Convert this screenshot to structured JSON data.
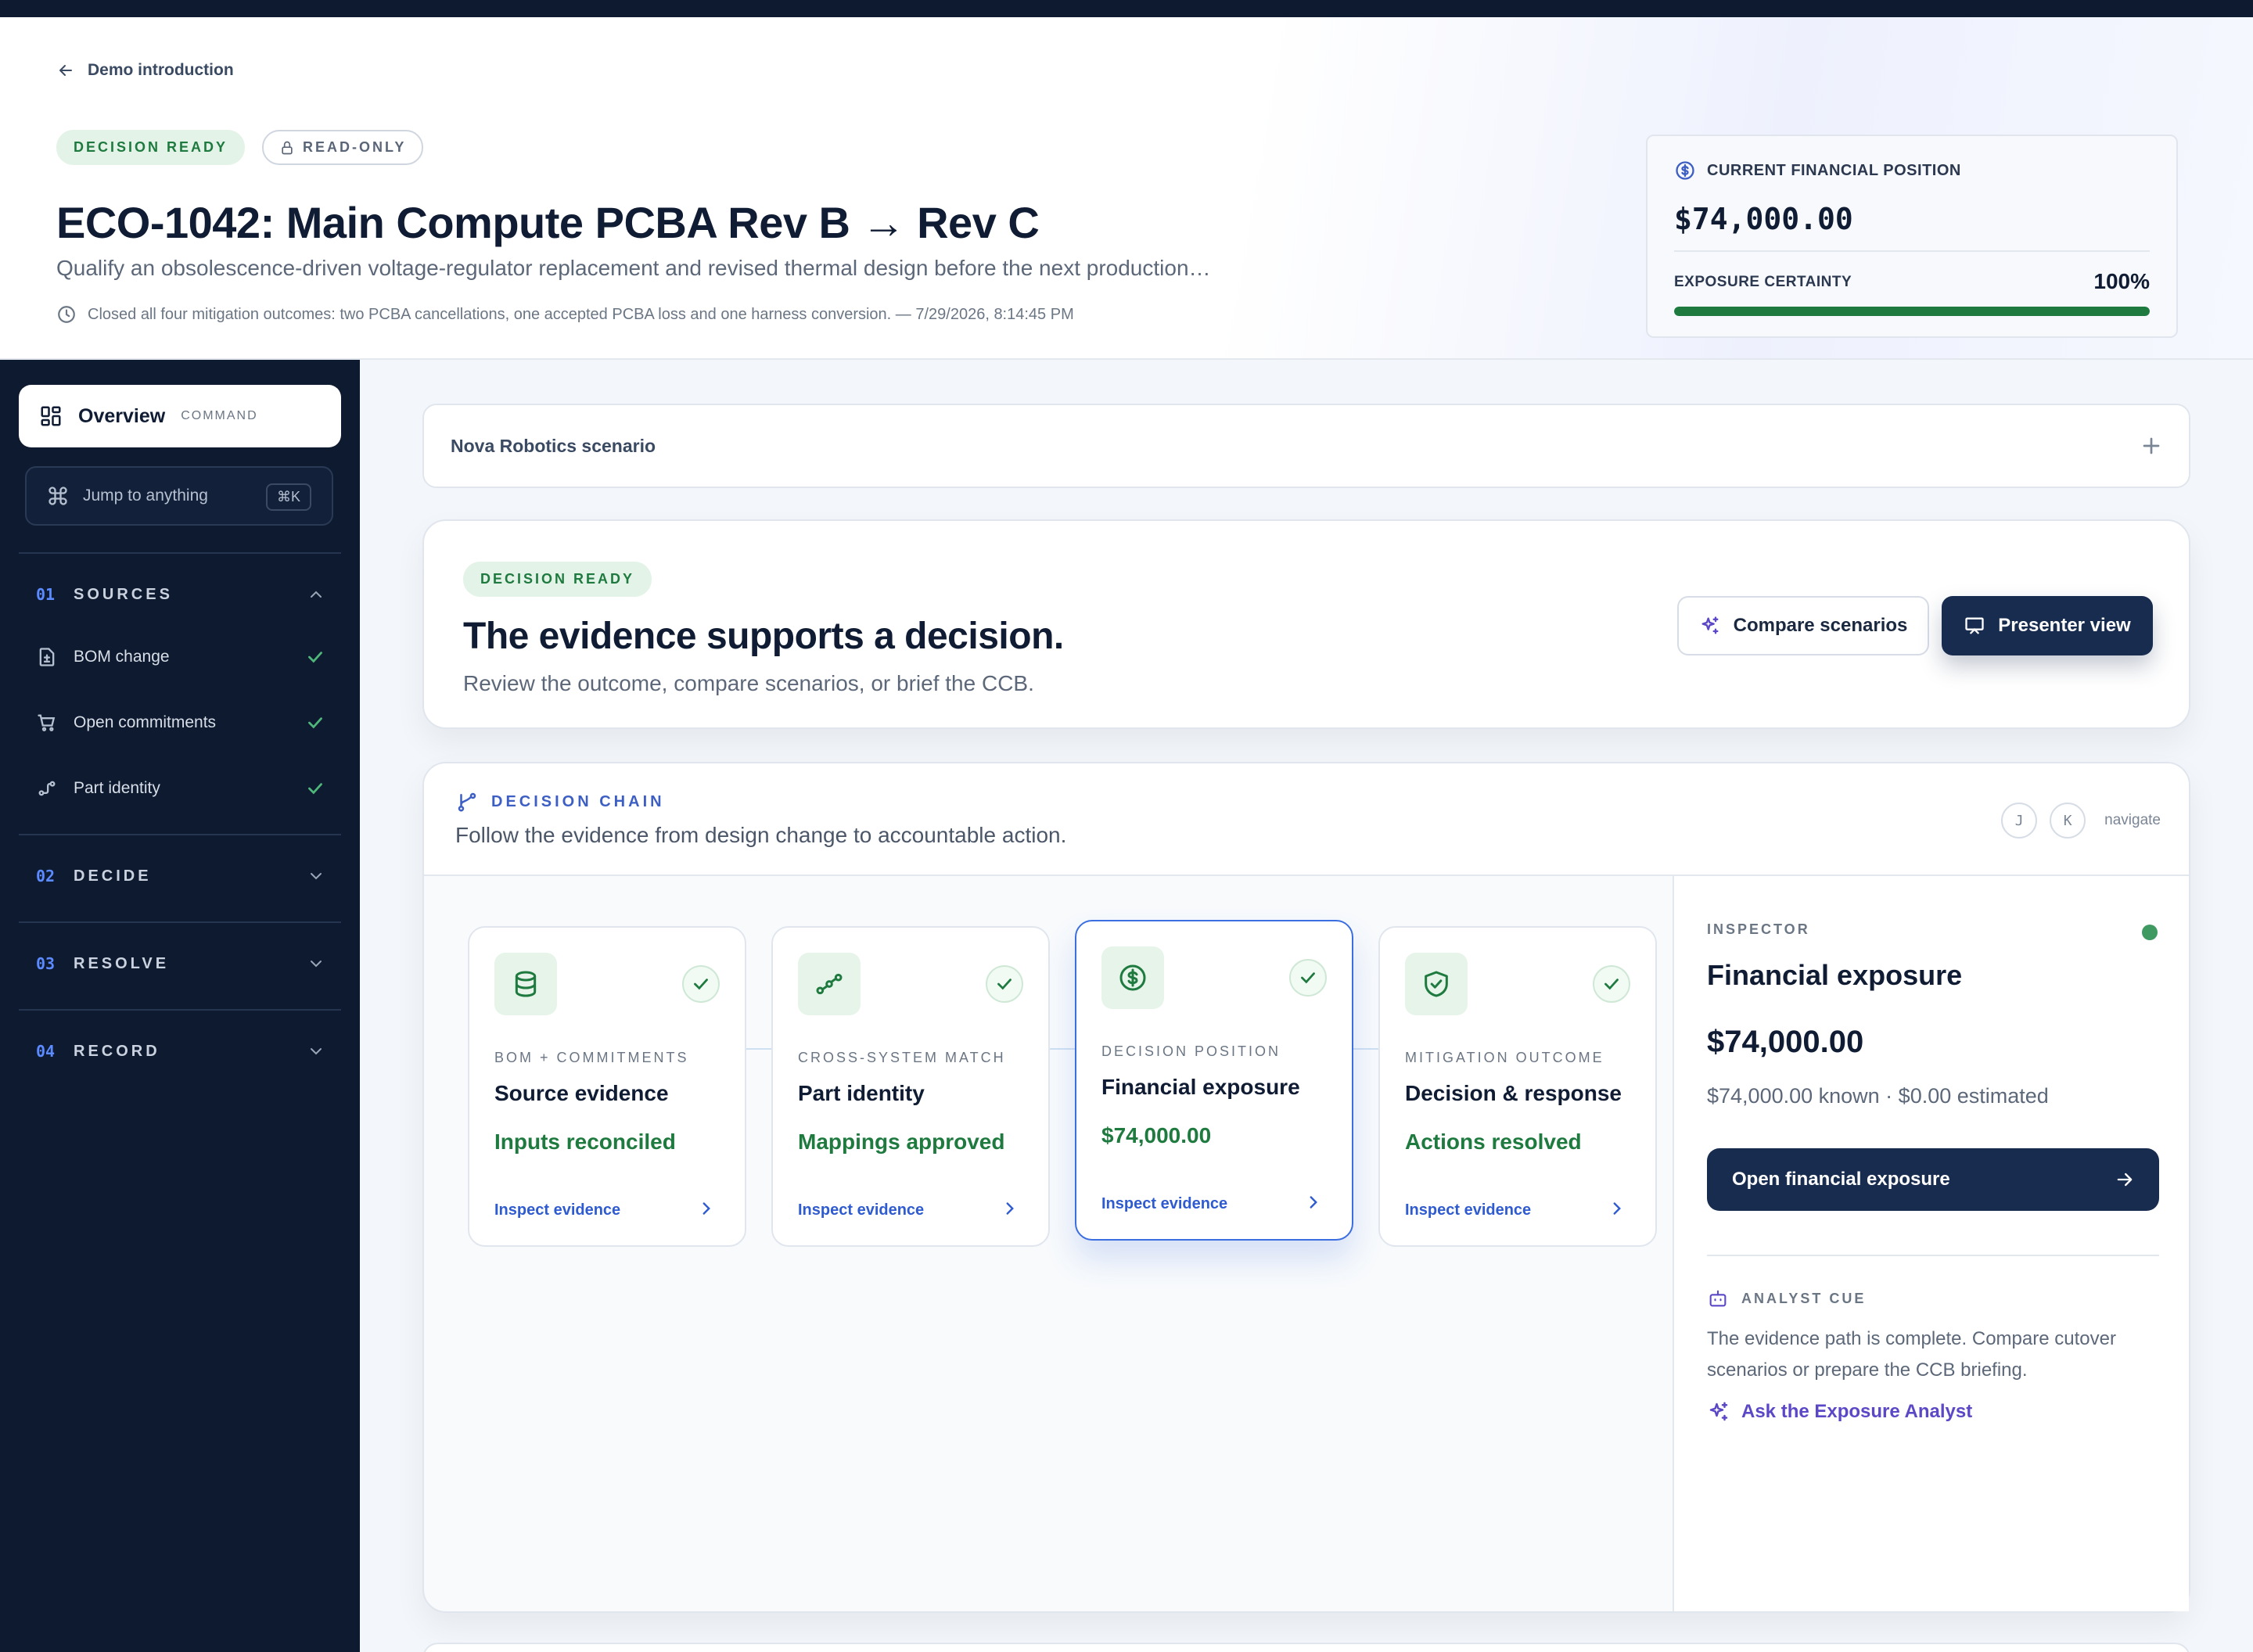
{
  "header": {
    "back_label": "Demo introduction",
    "status_badge": "DECISION READY",
    "access_badge": "READ-ONLY",
    "title": "ECO-1042: Main Compute PCBA Rev B → Rev C",
    "subtitle": "Qualify an obsolescence-driven voltage-regulator replacement and revised thermal design before the next production…",
    "meta": "Closed all four mitigation outcomes: two PCBA cancellations, one accepted PCBA loss and one harness conversion. — 7/29/2026, 8:14:45 PM"
  },
  "financial": {
    "label": "CURRENT FINANCIAL POSITION",
    "value": "$74,000.00",
    "certainty_label": "EXPOSURE CERTAINTY",
    "certainty_value": "100%",
    "certainty_fraction": 1.0,
    "bar_color": "#1e7a3e"
  },
  "sidebar": {
    "overview_label": "Overview",
    "overview_tag": "COMMAND",
    "jump_label": "Jump to anything",
    "jump_shortcut": "⌘K",
    "sections": [
      {
        "num": "01",
        "name": "SOURCES",
        "expanded": true,
        "items": [
          {
            "label": "BOM change",
            "icon": "file-diff-icon",
            "done": true
          },
          {
            "label": "Open commitments",
            "icon": "cart-icon",
            "done": true
          },
          {
            "label": "Part identity",
            "icon": "link-icon",
            "done": true
          }
        ]
      },
      {
        "num": "02",
        "name": "DECIDE",
        "expanded": false
      },
      {
        "num": "03",
        "name": "RESOLVE",
        "expanded": false
      },
      {
        "num": "04",
        "name": "RECORD",
        "expanded": false
      }
    ]
  },
  "scenario": {
    "label": "Nova Robotics scenario"
  },
  "decision": {
    "badge": "DECISION READY",
    "title": "The evidence supports a decision.",
    "subtitle": "Review the outcome, compare scenarios, or brief the CCB.",
    "compare_label": "Compare scenarios",
    "presenter_label": "Presenter view"
  },
  "chain": {
    "label": "DECISION CHAIN",
    "subtitle": "Follow the evidence from design change to accountable action.",
    "nav_key_1": "J",
    "nav_key_2": "K",
    "nav_text": "navigate",
    "steps": [
      {
        "kicker": "BOM + COMMITMENTS",
        "title": "Source evidence",
        "status": "Inputs reconciled",
        "link": "Inspect evidence",
        "icon": "database-icon"
      },
      {
        "kicker": "CROSS-SYSTEM MATCH",
        "title": "Part identity",
        "status": "Mappings approved",
        "link": "Inspect evidence",
        "icon": "connect-icon"
      },
      {
        "kicker": "DECISION POSITION",
        "title": "Financial exposure",
        "status": "$74,000.00",
        "link": "Inspect evidence",
        "icon": "dollar-icon",
        "active": true
      },
      {
        "kicker": "MITIGATION OUTCOME",
        "title": "Decision & response",
        "status": "Actions resolved",
        "link": "Inspect evidence",
        "icon": "shield-check-icon"
      }
    ]
  },
  "inspector": {
    "kicker": "INSPECTOR",
    "title": "Financial exposure",
    "value": "$74,000.00",
    "breakdown": "$74,000.00 known · $0.00 estimated",
    "button_label": "Open financial exposure",
    "cue_label": "ANALYST CUE",
    "cue_text": "The evidence path is complete. Compare cutover scenarios or prepare the CCB briefing.",
    "cue_link": "Ask the Exposure Analyst"
  },
  "colors": {
    "navy": "#0e1a30",
    "primary_button": "#172c4f",
    "success": "#1e7a3e",
    "accent_blue": "#3b6ee0",
    "analyst_purple": "#5b48c6"
  }
}
